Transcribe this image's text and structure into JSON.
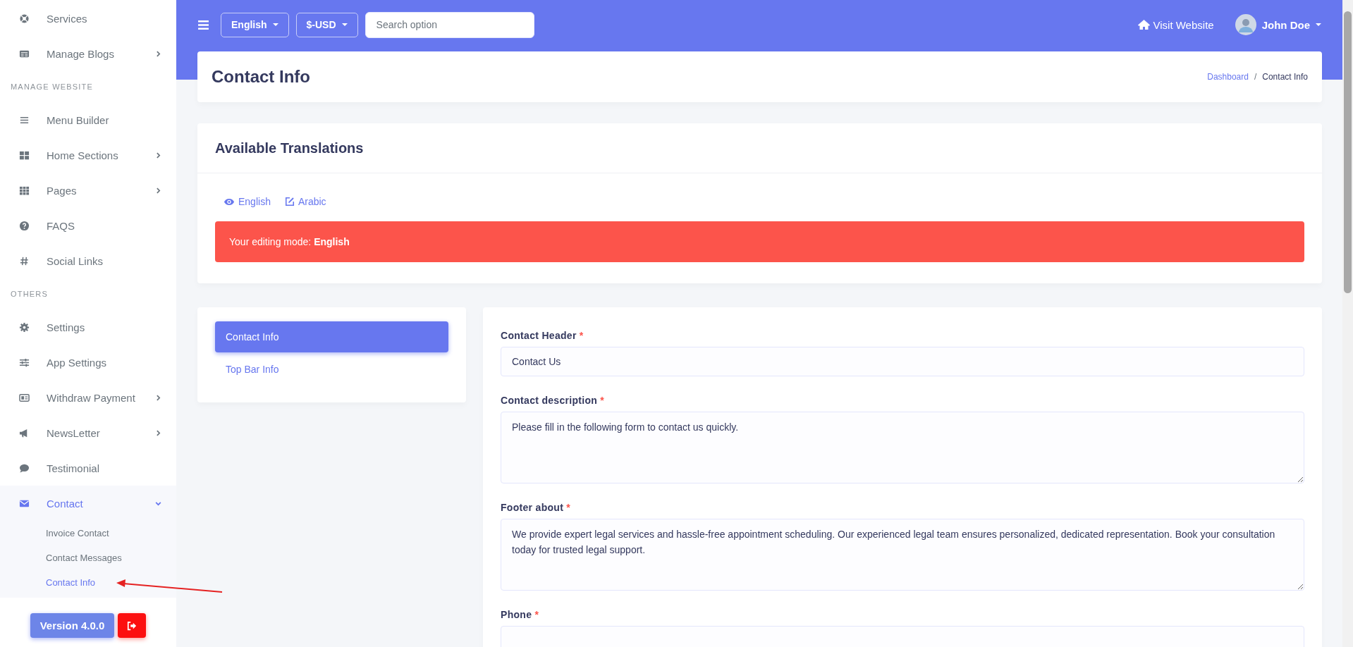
{
  "sidebar": {
    "items": [
      {
        "kind": "item",
        "label": "Services",
        "selected": false
      },
      {
        "kind": "item",
        "label": "Manage Blogs",
        "selected": false,
        "expanded": false
      },
      {
        "kind": "heading",
        "label": "MANAGE WEBSITE"
      },
      {
        "kind": "item",
        "label": "Menu Builder",
        "selected": false
      },
      {
        "kind": "item",
        "label": "Home Sections",
        "selected": false,
        "expanded": false
      },
      {
        "kind": "item",
        "label": "Pages",
        "selected": false,
        "expanded": false
      },
      {
        "kind": "item",
        "label": "FAQS",
        "selected": false
      },
      {
        "kind": "item",
        "label": "Social Links",
        "selected": false
      },
      {
        "kind": "heading",
        "label": "OTHERS"
      },
      {
        "kind": "item",
        "label": "Settings",
        "selected": false
      },
      {
        "kind": "item",
        "label": "App Settings",
        "selected": false
      },
      {
        "kind": "item",
        "label": "Withdraw Payment",
        "selected": false,
        "expanded": false
      },
      {
        "kind": "item",
        "label": "NewsLetter",
        "selected": false,
        "expanded": false
      },
      {
        "kind": "item",
        "label": "Testimonial",
        "selected": false
      },
      {
        "kind": "item",
        "label": "Contact",
        "selected": true,
        "expanded": true,
        "children": [
          {
            "label": "Invoice Contact",
            "selected": false
          },
          {
            "label": "Contact Messages",
            "selected": false
          },
          {
            "label": "Contact Info",
            "selected": true
          }
        ]
      }
    ],
    "version": "Version 4.0.0"
  },
  "topbar": {
    "language": "English",
    "currency": "$-USD",
    "search": {
      "placeholder": "Search option"
    },
    "visit": "Visit Website",
    "user": "John Doe"
  },
  "page_header": {
    "title": "Contact Info",
    "breadcrumb": [
      "Dashboard",
      "Contact Info"
    ],
    "breadcrumb_separator": "/"
  },
  "translations": {
    "title": "Available Translations",
    "languages": [
      {
        "label": "English",
        "selected": true
      },
      {
        "label": "Arabic",
        "selected": false
      }
    ],
    "alert": "Your editing mode: **English**"
  },
  "tabs": [
    {
      "label": "Contact Info",
      "selected": true
    },
    {
      "label": "Top Bar Info",
      "selected": false
    }
  ],
  "form": {
    "fields": [
      {
        "kind": "input",
        "label": "Contact Header",
        "mark": "*",
        "value": "Contact Us"
      },
      {
        "kind": "textarea",
        "label": "Contact description",
        "mark": "*",
        "value": "Please fill in the following form to contact us quickly."
      },
      {
        "kind": "textarea",
        "label": "Footer about",
        "mark": "*",
        "value": "We provide expert legal services and hassle-free appointment scheduling. Our experienced legal team ensures personalized, dedicated representation. Book your consultation today for trusted legal support."
      },
      {
        "kind": "input",
        "label": "Phone",
        "mark": "*"
      }
    ]
  }
}
